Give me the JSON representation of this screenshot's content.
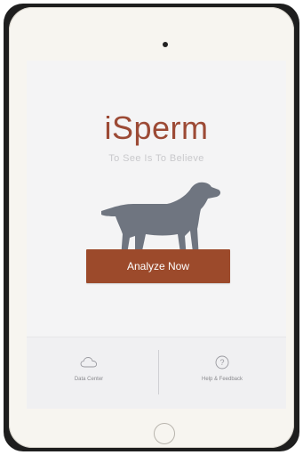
{
  "app": {
    "title": "iSperm",
    "subtitle": "To See Is To Believe"
  },
  "main": {
    "analyze_label": "Analyze Now"
  },
  "bottom_bar": {
    "items": [
      {
        "label": "Data Center",
        "icon": "cloud-icon"
      },
      {
        "label": "Help & Feedback",
        "icon": "question-circle-icon"
      }
    ]
  },
  "colors": {
    "brand": "#9c4a35",
    "button": "#9c4a2b",
    "dog": "#6f7580"
  }
}
